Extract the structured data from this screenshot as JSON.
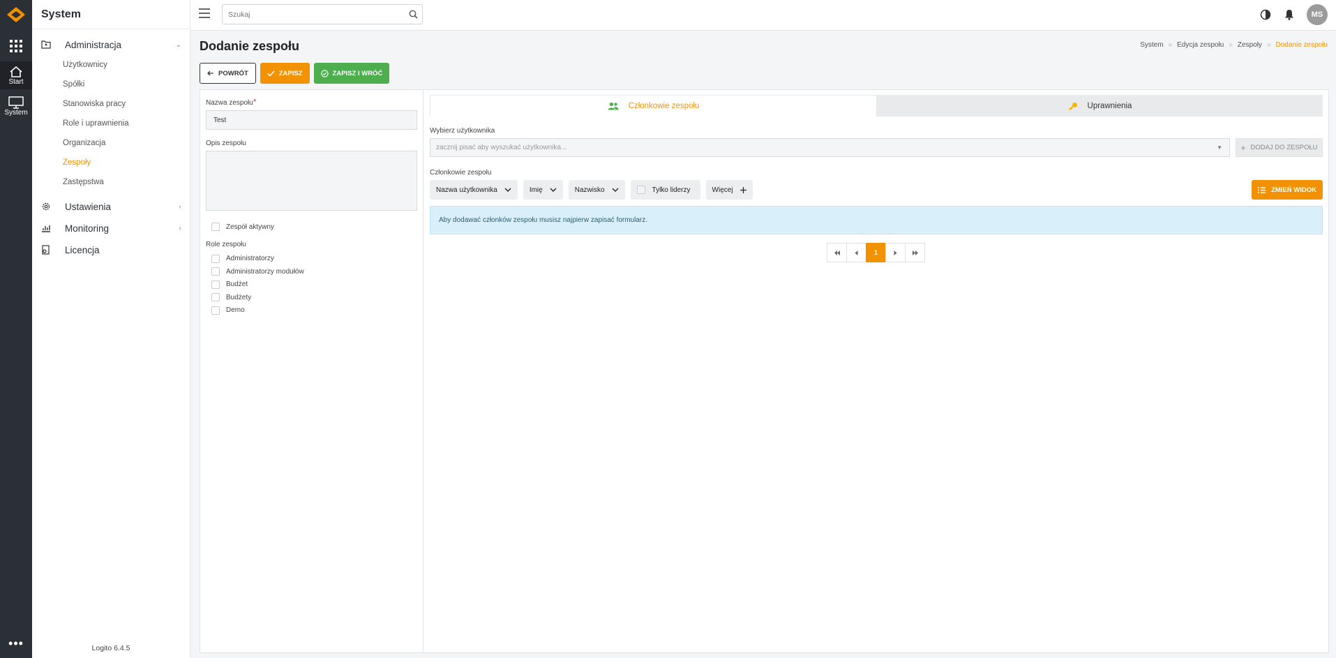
{
  "rail": {
    "items": [
      {
        "label": "Start"
      },
      {
        "label": "System"
      }
    ],
    "more": "•••"
  },
  "sidebar": {
    "title": "System",
    "groups": [
      {
        "label": "Administracja",
        "expanded": true
      },
      {
        "label": "Ustawienia"
      },
      {
        "label": "Monitoring"
      },
      {
        "label": "Licencja"
      }
    ],
    "admin_items": [
      "Użytkownicy",
      "Spółki",
      "Stanowiska pracy",
      "Role i uprawnienia",
      "Organizacja",
      "Zespoły",
      "Zastępstwa"
    ],
    "active_item": "Zespoły",
    "footer": "Logito 6.4.5"
  },
  "topbar": {
    "search_placeholder": "Szukaj",
    "avatar_initials": "MS"
  },
  "page": {
    "title": "Dodanie zespołu",
    "breadcrumb": [
      "System",
      "Edycja zespołu",
      "Zespoły",
      "Dodanie zespołu"
    ]
  },
  "actions": {
    "back": "POWRÓT",
    "save": "ZAPISZ",
    "save_return": "ZAPISZ I WRÓĆ"
  },
  "form": {
    "name_label": "Nazwa zespołu",
    "name_required_mark": "*",
    "name_value": "Test",
    "description_label": "Opis zespołu",
    "active_label": "Zespół aktywny",
    "roles_label": "Role zespołu",
    "roles": [
      "Administratorzy",
      "Administratorzy modułów",
      "Budżet",
      "Budżety",
      "Demo"
    ]
  },
  "tabs": {
    "members": "Członkowie zespołu",
    "permissions": "Uprawnienia"
  },
  "members": {
    "select_user_label": "Wybierz użytkownika",
    "select_placeholder": "zacznij pisać aby wyszukać użytkownika...",
    "add_button": "DODAJ DO ZESPOŁU",
    "list_label": "Członkowie zespołu",
    "filters": {
      "username": "Nazwa użytkownika",
      "first_name": "Imię",
      "last_name": "Nazwisko",
      "leaders_only": "Tylko liderzy",
      "more": "Więcej"
    },
    "change_view": "ZMIEŃ WIDOK",
    "info_message": "Aby dodawać członków zespołu musisz najpierw zapisać formularz.",
    "pagination": {
      "current_page": "1"
    }
  },
  "colors": {
    "accent": "#f39200",
    "success": "#4cae4c",
    "rail": "#2b2f36",
    "info_bg": "#d9f0fa"
  }
}
